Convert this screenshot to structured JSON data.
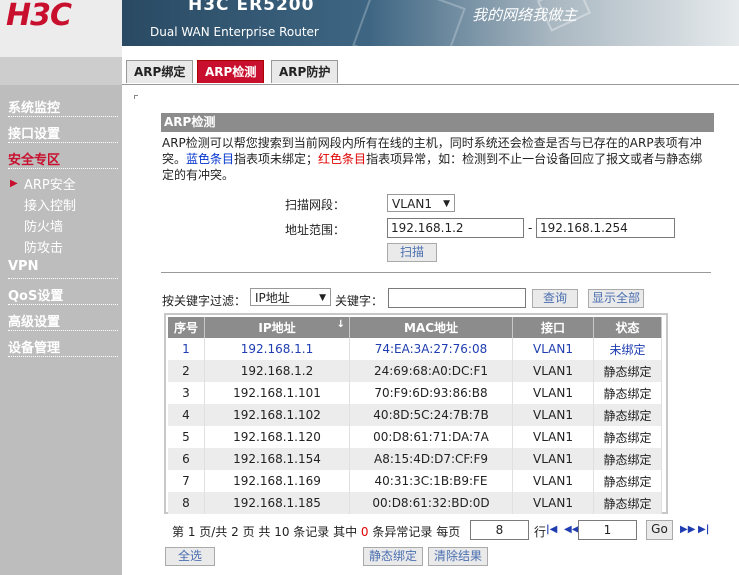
{
  "brand": {
    "logo": "H3C",
    "model": "H3C ER5200",
    "subtitle": "Dual WAN Enterprise Router",
    "slogan": "我的网络我做主"
  },
  "tabs": [
    {
      "label": "ARP绑定"
    },
    {
      "label": "ARP检测"
    },
    {
      "label": "ARP防护"
    }
  ],
  "sidebar": {
    "items": [
      {
        "label": "系统监控"
      },
      {
        "label": "接口设置"
      },
      {
        "label": "安全专区"
      },
      {
        "label": "VPN"
      },
      {
        "label": "QoS设置"
      },
      {
        "label": "高级设置"
      },
      {
        "label": "设备管理"
      }
    ],
    "subitems": [
      {
        "label": "ARP安全"
      },
      {
        "label": "接入控制"
      },
      {
        "label": "防火墙"
      },
      {
        "label": "防攻击"
      }
    ]
  },
  "section": {
    "title": "ARP检测",
    "desc_1": "ARP检测可以帮您搜索到当前网段内所有在线的主机，同时系统还会检查是否与已存在的ARP表项有冲突。",
    "desc_blue": "蓝色条目",
    "desc_2": "指表项未绑定；",
    "desc_red": "红色条目",
    "desc_3": "指表项异常，如：检测到不止一台设备回应了报文或者与静态绑定的有冲突。"
  },
  "scan": {
    "segment_label": "扫描网段：",
    "segment_value": "VLAN1",
    "range_label": "地址范围：",
    "range_start": "192.168.1.2",
    "range_dash": "-",
    "range_end": "192.168.1.254",
    "scan_button": "扫描"
  },
  "filter": {
    "label": "按关键字过滤：",
    "field_value": "IP地址",
    "keyword_label": "关键字：",
    "keyword_value": "",
    "search_button": "查询",
    "show_all_button": "显示全部"
  },
  "table": {
    "headers": {
      "no": "序号",
      "ip": "IP地址",
      "sort_icon": "↓",
      "mac": "MAC地址",
      "iface": "接口",
      "status": "状态"
    },
    "rows": [
      {
        "no": "1",
        "ip": "192.168.1.1",
        "mac": "74:EA:3A:27:76:08",
        "iface": "VLAN1",
        "status": "未绑定"
      },
      {
        "no": "2",
        "ip": "192.168.1.2",
        "mac": "24:69:68:A0:DC:F1",
        "iface": "VLAN1",
        "status": "静态绑定"
      },
      {
        "no": "3",
        "ip": "192.168.1.101",
        "mac": "70:F9:6D:93:86:B8",
        "iface": "VLAN1",
        "status": "静态绑定"
      },
      {
        "no": "4",
        "ip": "192.168.1.102",
        "mac": "40:8D:5C:24:7B:7B",
        "iface": "VLAN1",
        "status": "静态绑定"
      },
      {
        "no": "5",
        "ip": "192.168.1.120",
        "mac": "00:D8:61:71:DA:7A",
        "iface": "VLAN1",
        "status": "静态绑定"
      },
      {
        "no": "6",
        "ip": "192.168.1.154",
        "mac": "A8:15:4D:D7:CF:F9",
        "iface": "VLAN1",
        "status": "静态绑定"
      },
      {
        "no": "7",
        "ip": "192.168.1.169",
        "mac": "40:31:3C:1B:B9:FE",
        "iface": "VLAN1",
        "status": "静态绑定"
      },
      {
        "no": "8",
        "ip": "192.168.1.185",
        "mac": "00:D8:61:32:BD:0D",
        "iface": "VLAN1",
        "status": "静态绑定"
      }
    ]
  },
  "pager": {
    "text_1": "第 1 页/共 2 页 共 10 条记录 其中 ",
    "abnormal": "0",
    "text_2": " 条异常记录 每页",
    "per_page": "8",
    "rows_label": "行",
    "page_value": "1",
    "go_button": "Go"
  },
  "actions": {
    "select_all": "全选",
    "static_bind": "静态绑定",
    "clear": "清除结果"
  },
  "colors": {
    "accent": "#c8102e",
    "link_blue": "#1f3db0",
    "header_gray": "#8c8c8c"
  }
}
